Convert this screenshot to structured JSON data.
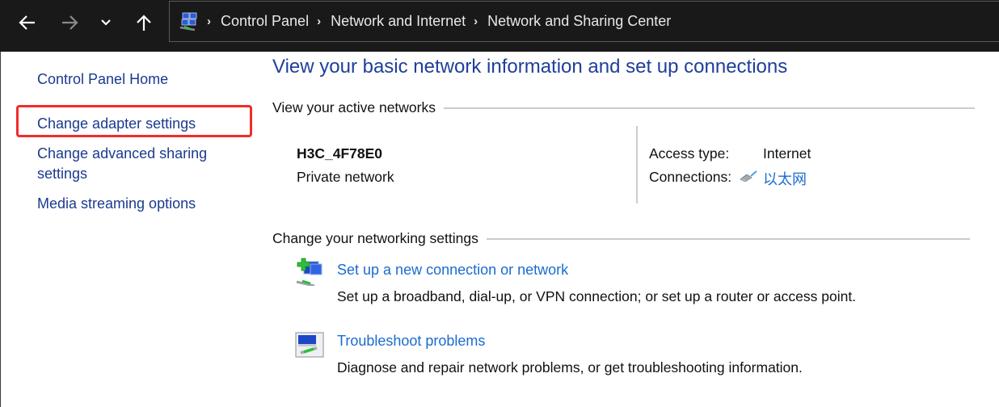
{
  "nav": {
    "back_icon": "arrow-left-icon",
    "forward_icon": "arrow-right-icon",
    "recent_icon": "chevron-down-icon",
    "up_icon": "arrow-up-icon"
  },
  "breadcrumb": {
    "icon": "control-panel-network-icon",
    "items": [
      "Control Panel",
      "Network and Internet",
      "Network and Sharing Center"
    ],
    "separator": "›"
  },
  "sidebar": {
    "items": [
      {
        "label": "Control Panel Home"
      },
      {
        "label": "Change adapter settings",
        "highlighted": true
      },
      {
        "label": "Change advanced sharing settings",
        "line1": "Change advanced sharing",
        "line2": "settings"
      },
      {
        "label": "Media streaming options"
      }
    ],
    "highlight_color": "#f22b2b"
  },
  "main": {
    "title": "View your basic network information and set up connections",
    "active_networks": {
      "heading": "View your active networks",
      "network": {
        "name": "H3C_4F78E0",
        "type": "Private network",
        "access_type_label": "Access type:",
        "access_type_value": "Internet",
        "connections_label": "Connections:",
        "connection_icon": "ethernet-cable-icon",
        "connection_name": "以太网"
      }
    },
    "networking_settings": {
      "heading": "Change your networking settings",
      "tasks": [
        {
          "icon": "new-connection-icon",
          "link": "Set up a new connection or network",
          "description": "Set up a broadband, dial-up, or VPN connection; or set up a router or access point."
        },
        {
          "icon": "troubleshoot-icon",
          "link": "Troubleshoot problems",
          "description": "Diagnose and repair network problems, or get troubleshooting information."
        }
      ]
    }
  },
  "colors": {
    "titlebar_bg": "#191919",
    "heading_blue": "#1e3f9a",
    "link_blue": "#1a6ccf",
    "sidebar_link": "#1a3a8f"
  }
}
